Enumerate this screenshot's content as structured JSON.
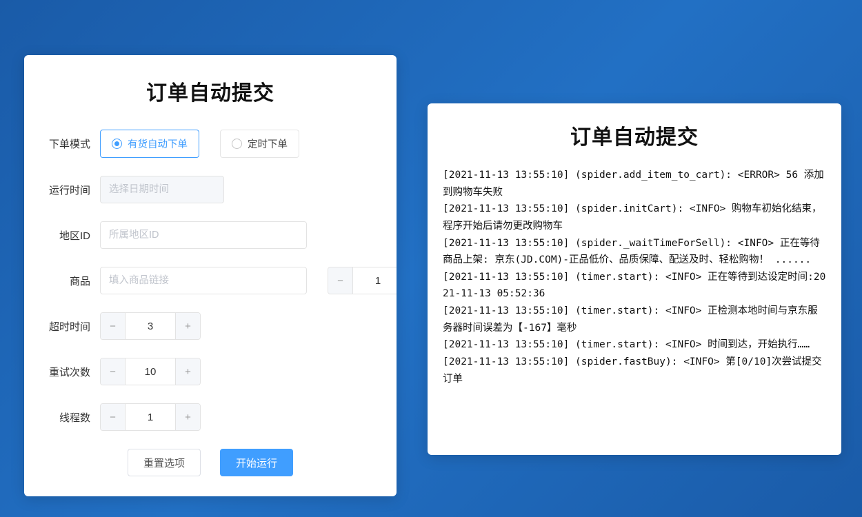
{
  "leftPanel": {
    "title": "订单自动提交",
    "form": {
      "modeLabel": "下单模式",
      "modeOptions": {
        "auto": "有货自动下单",
        "timed": "定时下单"
      },
      "runtimeLabel": "运行时间",
      "runtimePlaceholder": "选择日期时间",
      "regionLabel": "地区ID",
      "regionPlaceholder": "所属地区ID",
      "productLabel": "商品",
      "productPlaceholder": "填入商品链接",
      "productQty": "1",
      "timeoutLabel": "超时时间",
      "timeoutValue": "3",
      "retryLabel": "重试次数",
      "retryValue": "10",
      "threadsLabel": "线程数",
      "threadsValue": "1"
    },
    "buttons": {
      "reset": "重置选项",
      "start": "开始运行"
    }
  },
  "rightPanel": {
    "title": "订单自动提交",
    "log": "[2021-11-13 13:55:10] (spider.add_item_to_cart): <ERROR> 56 添加到购物车失败\n[2021-11-13 13:55:10] (spider.initCart): <INFO> 购物车初始化结束，程序开始后请勿更改购物车\n[2021-11-13 13:55:10] (spider._waitTimeForSell): <INFO> 正在等待商品上架: 京东(JD.COM)-正品低价、品质保障、配送及时、轻松购物！ ......\n[2021-11-13 13:55:10] (timer.start): <INFO> 正在等待到达设定时间:2021-11-13 05:52:36\n[2021-11-13 13:55:10] (timer.start): <INFO> 正检测本地时间与京东服务器时间误差为【-167】毫秒\n[2021-11-13 13:55:10] (timer.start): <INFO> 时间到达，开始执行……\n[2021-11-13 13:55:10] (spider.fastBuy): <INFO> 第[0/10]次尝试提交订单"
  }
}
